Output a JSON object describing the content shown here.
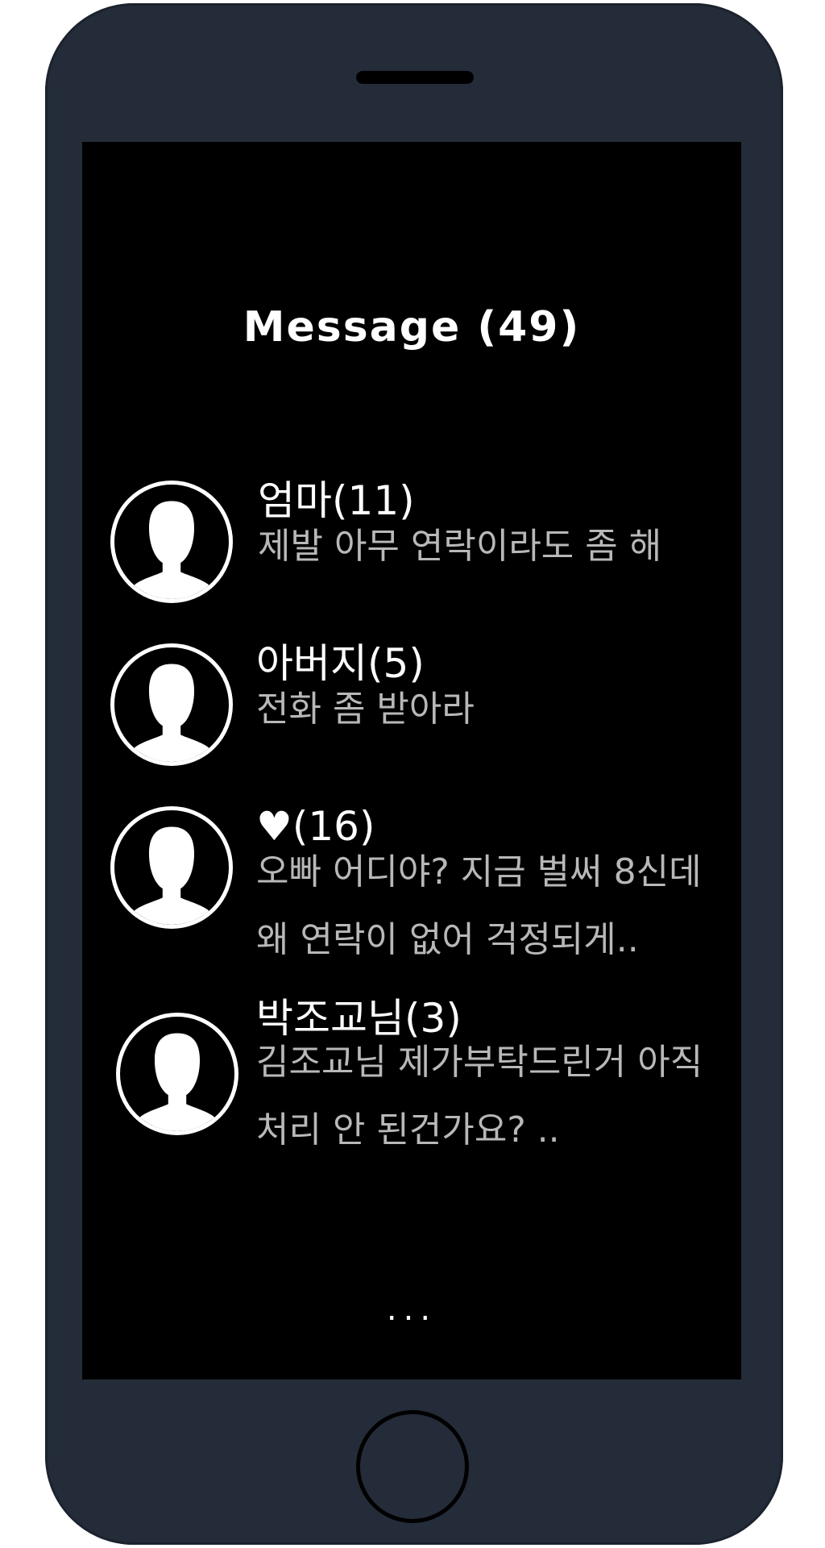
{
  "header": {
    "title": "Message",
    "count": "(49)"
  },
  "conversations": [
    {
      "name": "엄마",
      "count": "(11)",
      "preview": "제발 아무 연락이라도 좀 해"
    },
    {
      "name": "아버지",
      "count": "(5)",
      "preview": "전화 좀 받아라"
    },
    {
      "name": "♥",
      "count": "(16)",
      "preview": "오빠 어디야? 지금 벌써 8신데 왜 연락이 없어 걱정되게.."
    },
    {
      "name": "박조교님",
      "count": "(3)",
      "preview": "김조교님 제가부탁드린거 아직 처리 안 된건가요? .."
    }
  ],
  "footer": {
    "more": "..."
  },
  "colors": {
    "phone_body": "#242c39",
    "screen": "#000000",
    "title_text": "#ffffff",
    "preview_text": "#b8b8b8"
  },
  "icons": {
    "avatar": "person-silhouette-icon",
    "home": "home-button"
  }
}
